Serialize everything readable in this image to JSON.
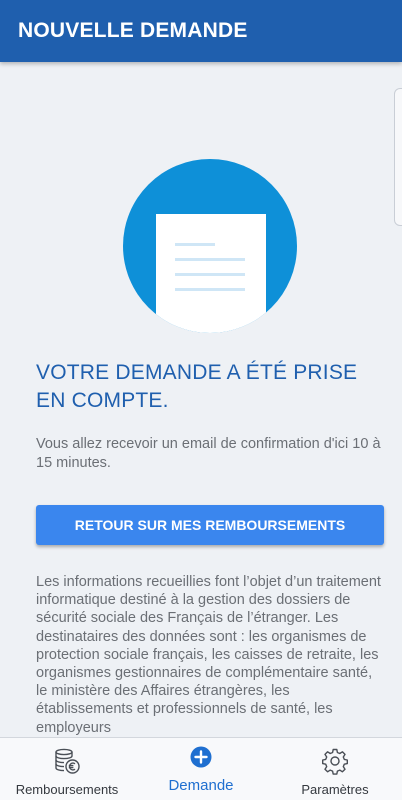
{
  "header": {
    "title": "NOUVELLE DEMANDE"
  },
  "confirmation": {
    "illustration_icon": "document-icon",
    "title": "VOTRE DEMANDE A ÉTÉ PRISE EN COMPTE.",
    "message": "Vous allez recevoir un email de confirmation d'ici 10 à 15 minutes.",
    "return_button_label": "RETOUR SUR MES REMBOURSEMENTS"
  },
  "legal": {
    "text": "Les informations recueillies font l’objet d’un traitement informatique destiné à la gestion des dossiers de sécurité sociale des Français de l’étranger. Les destinataires des données sont : les organismes de protection sociale français, les caisses de retraite, les organismes gestionnaires de complémentaire santé, le ministère des Affaires étrangères, les établissements et professionnels de santé, les employeurs"
  },
  "bottom_nav": {
    "items": [
      {
        "label": "Remboursements",
        "icon": "coins-euro-icon",
        "active": false
      },
      {
        "label": "Demande",
        "icon": "add-circle-icon",
        "active": true
      },
      {
        "label": "Paramètres",
        "icon": "gear-icon",
        "active": false
      }
    ]
  },
  "colors": {
    "header_bg": "#1f5fae",
    "title_blue": "#1f5fae",
    "illustration_blue": "#0e90d8",
    "button_blue": "#3a86ee",
    "nav_active": "#1f6fd0",
    "background": "#eef1f5"
  }
}
